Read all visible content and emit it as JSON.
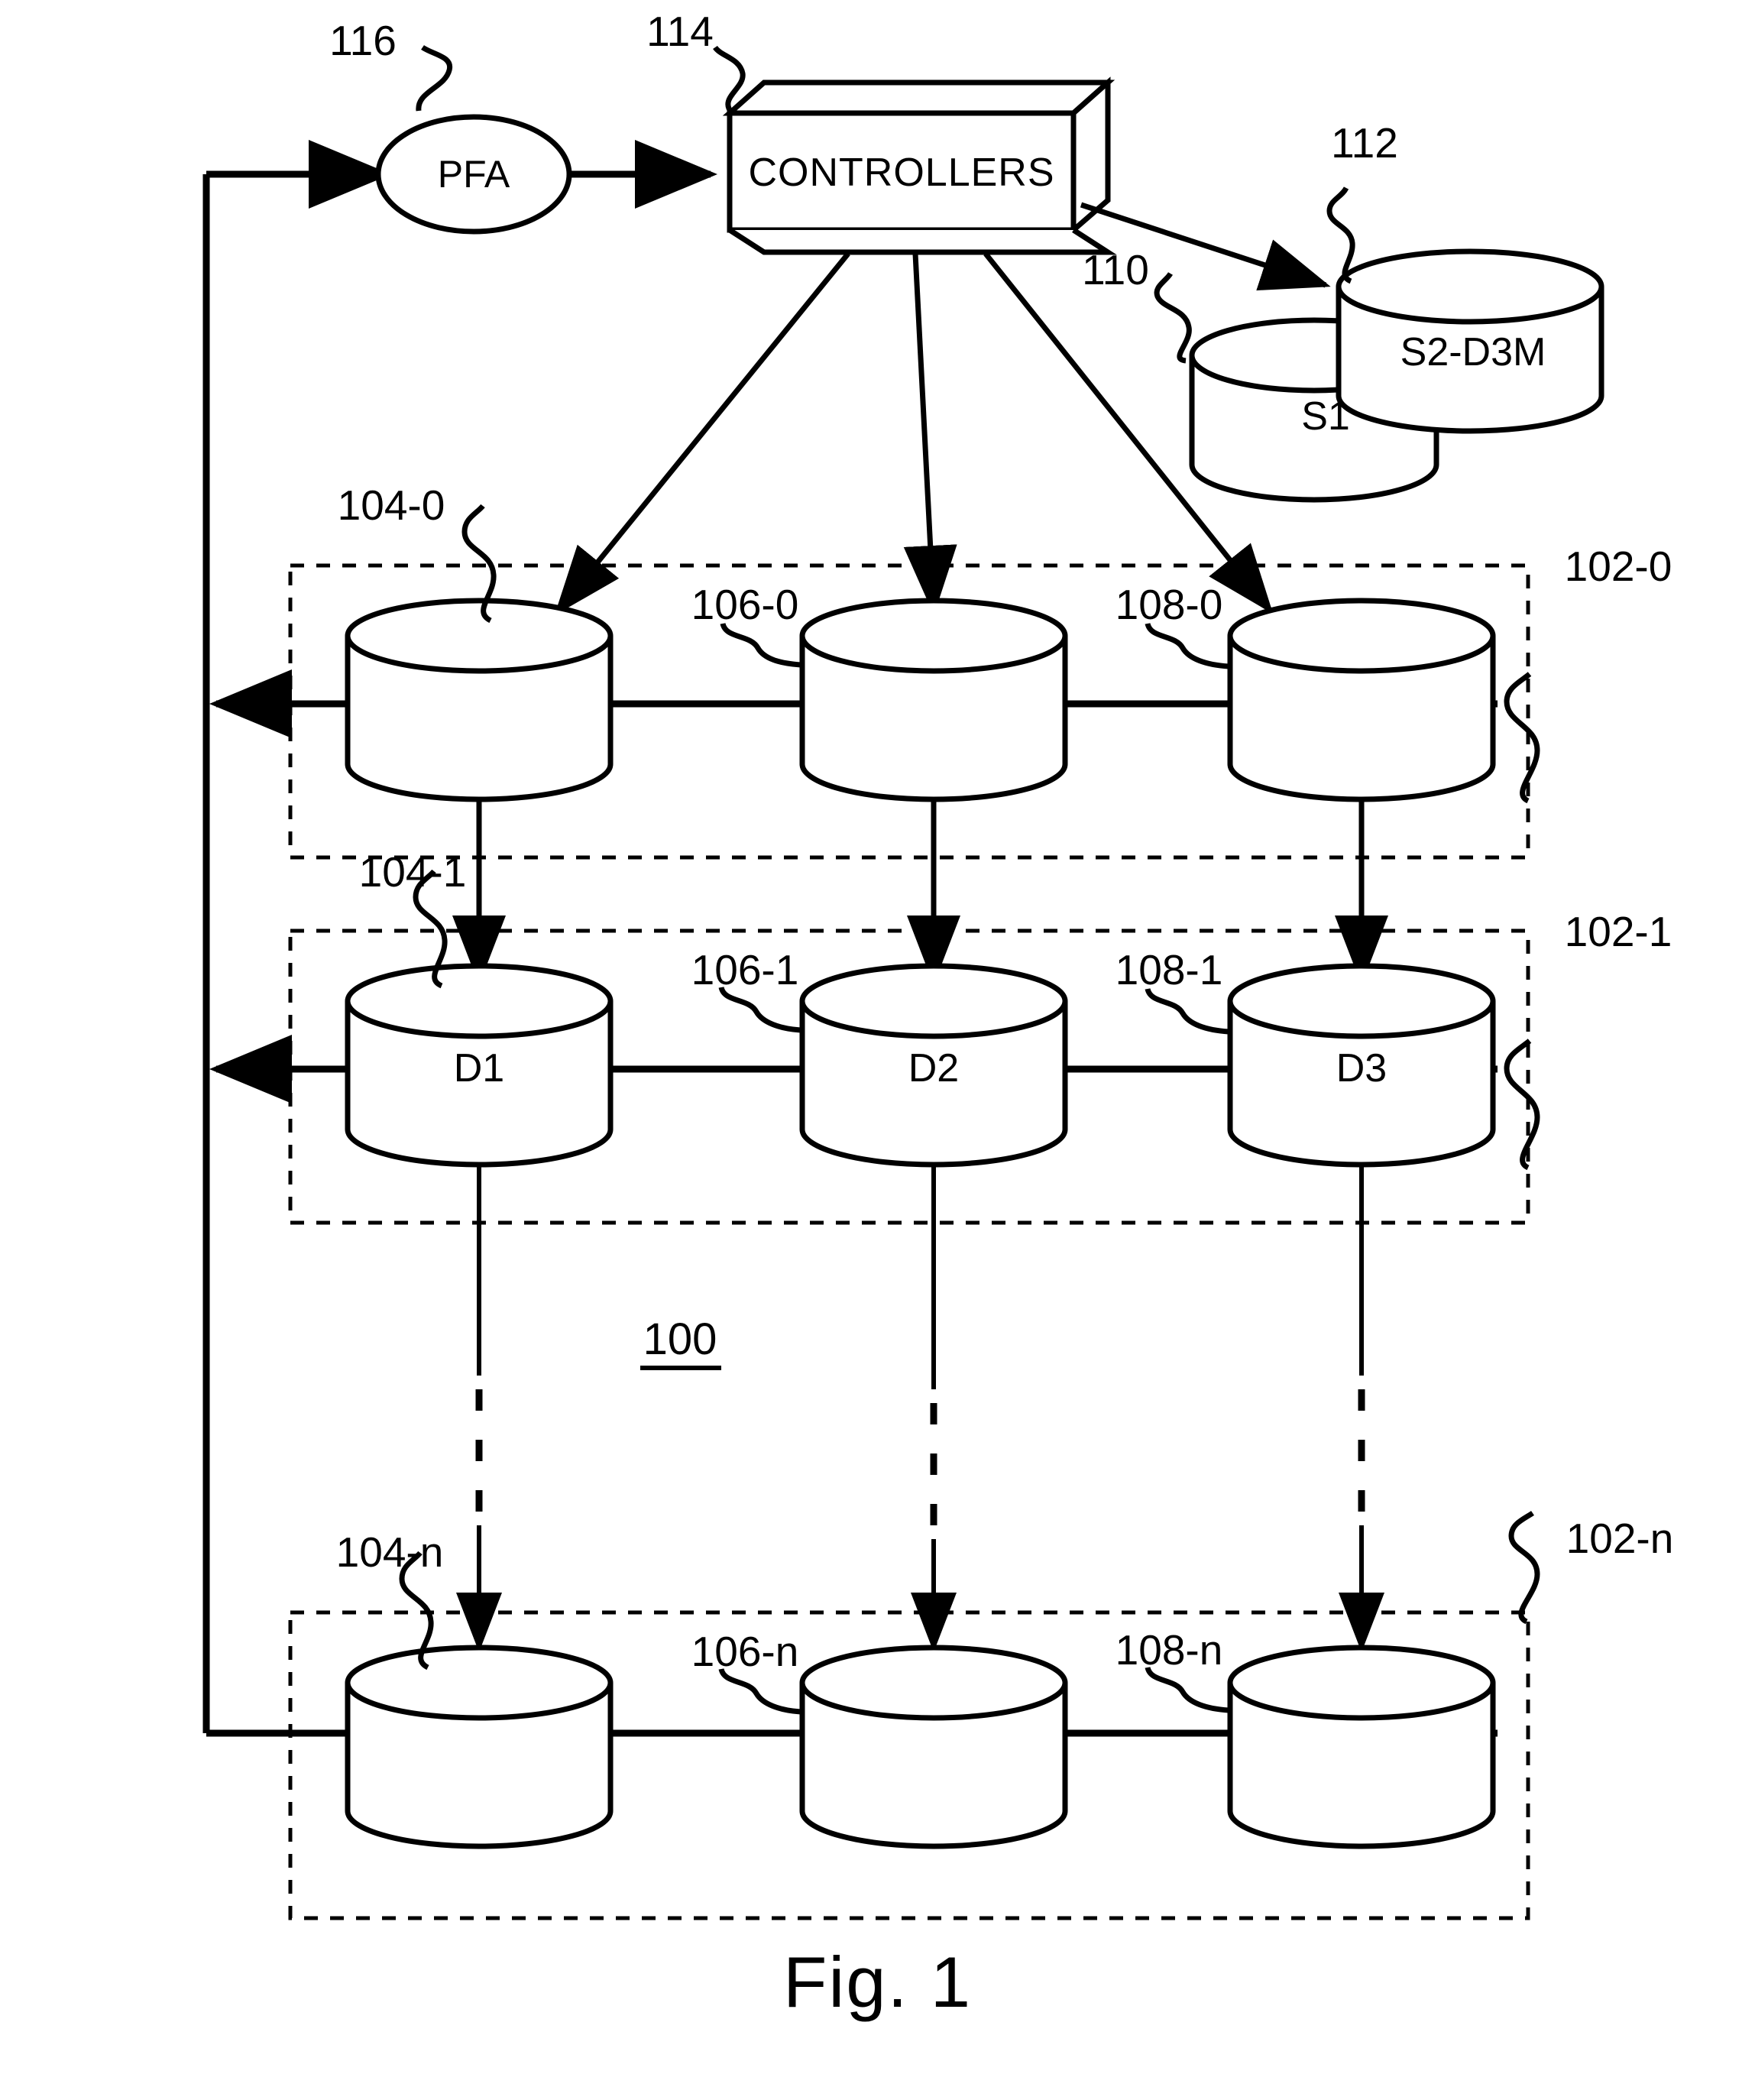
{
  "figure": {
    "caption": "Fig. 1",
    "system_label": "100"
  },
  "nodes": {
    "pfa": {
      "label": "PFA",
      "ref": "116"
    },
    "controllers": {
      "label": "CONTROLLERS",
      "ref": "114"
    },
    "s1": {
      "label": "S1",
      "ref": "110"
    },
    "s2d3m": {
      "label": "S2-D3M",
      "ref": "112"
    }
  },
  "rows": [
    {
      "ref": "102-0",
      "cells": [
        {
          "ref": "104-0",
          "label": ""
        },
        {
          "ref": "106-0",
          "label": ""
        },
        {
          "ref": "108-0",
          "label": ""
        }
      ]
    },
    {
      "ref": "102-1",
      "cells": [
        {
          "ref": "104-1",
          "label": "D1"
        },
        {
          "ref": "106-1",
          "label": "D2"
        },
        {
          "ref": "108-1",
          "label": "D3"
        }
      ]
    },
    {
      "ref": "102-n",
      "cells": [
        {
          "ref": "104-n",
          "label": ""
        },
        {
          "ref": "106-n",
          "label": ""
        },
        {
          "ref": "108-n",
          "label": ""
        }
      ]
    }
  ],
  "colors": {
    "stroke": "#000000",
    "background": "#ffffff"
  }
}
